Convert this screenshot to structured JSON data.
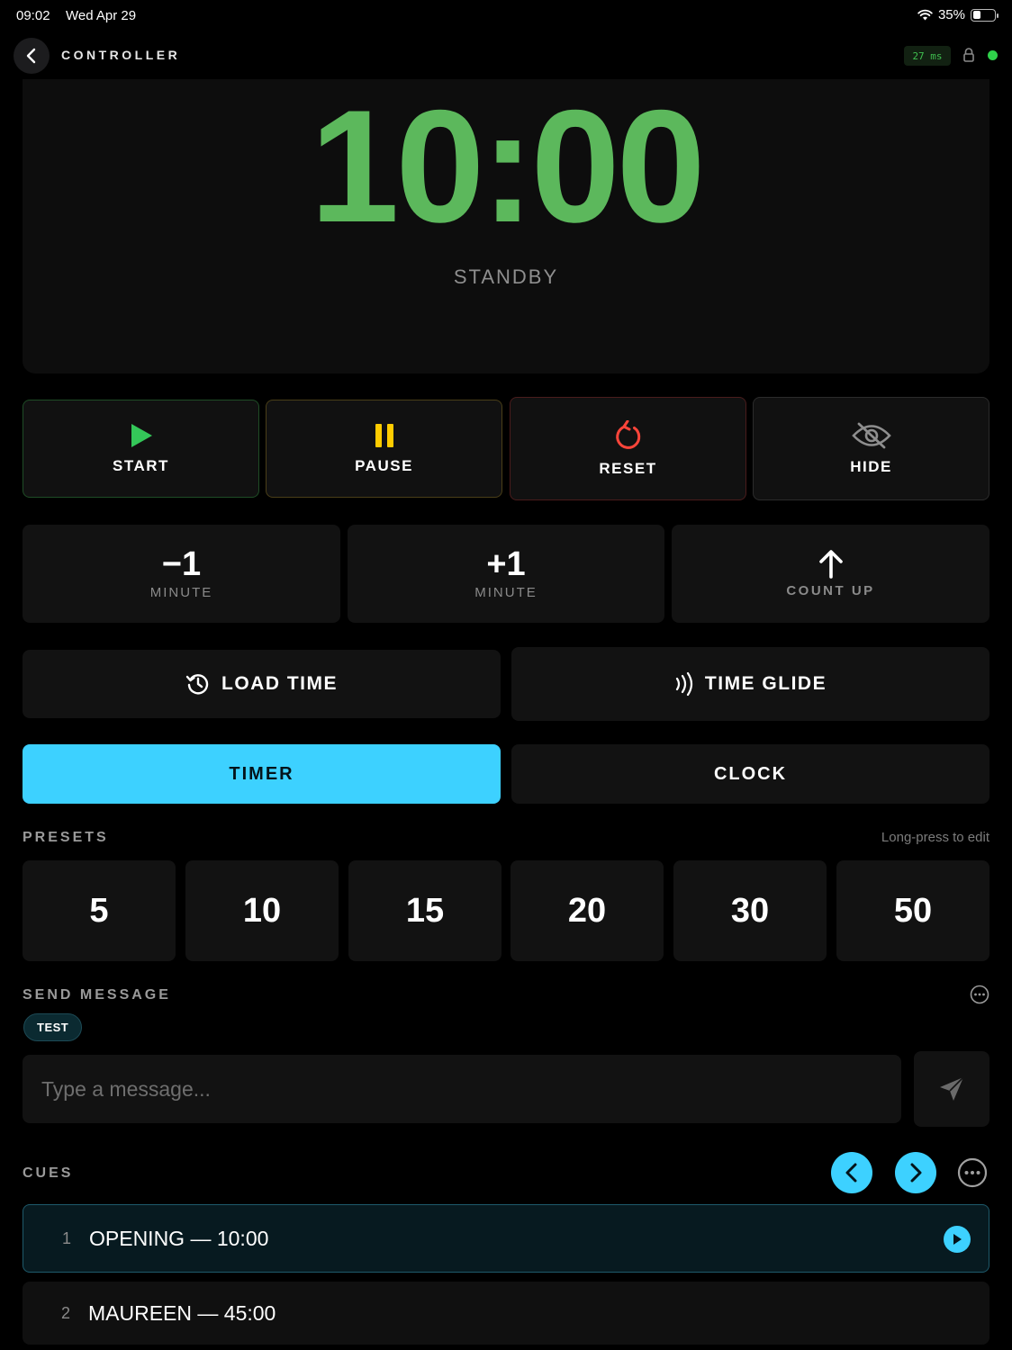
{
  "status_bar": {
    "time": "09:02",
    "date": "Wed Apr 29",
    "battery": "35%"
  },
  "header": {
    "title": "CONTROLLER",
    "latency": "27 ms"
  },
  "timer": {
    "display": "10:00",
    "state": "STANDBY",
    "color": "#5cb85c"
  },
  "controls": {
    "start": "START",
    "pause": "PAUSE",
    "reset": "RESET",
    "hide": "HIDE"
  },
  "adjust": {
    "minus": {
      "value": "−1",
      "unit": "MINUTE"
    },
    "plus": {
      "value": "+1",
      "unit": "MINUTE"
    },
    "count_up": {
      "label": "COUNT UP"
    }
  },
  "actions": {
    "load_time": "LOAD TIME",
    "time_glide": "TIME GLIDE"
  },
  "modes": {
    "timer": "TIMER",
    "clock": "CLOCK",
    "active": "timer",
    "accent": "#3dd1ff"
  },
  "presets": {
    "label": "PRESETS",
    "hint": "Long-press to edit",
    "items": [
      "5",
      "10",
      "15",
      "20",
      "30",
      "50"
    ]
  },
  "message": {
    "label": "SEND MESSAGE",
    "chips": [
      "TEST"
    ],
    "placeholder": "Type a message..."
  },
  "cues": {
    "label": "CUES",
    "items": [
      {
        "number": "1",
        "title": "OPENING — 10:00",
        "active": true
      },
      {
        "number": "2",
        "title": "MAUREEN — 45:00",
        "active": false
      }
    ]
  }
}
